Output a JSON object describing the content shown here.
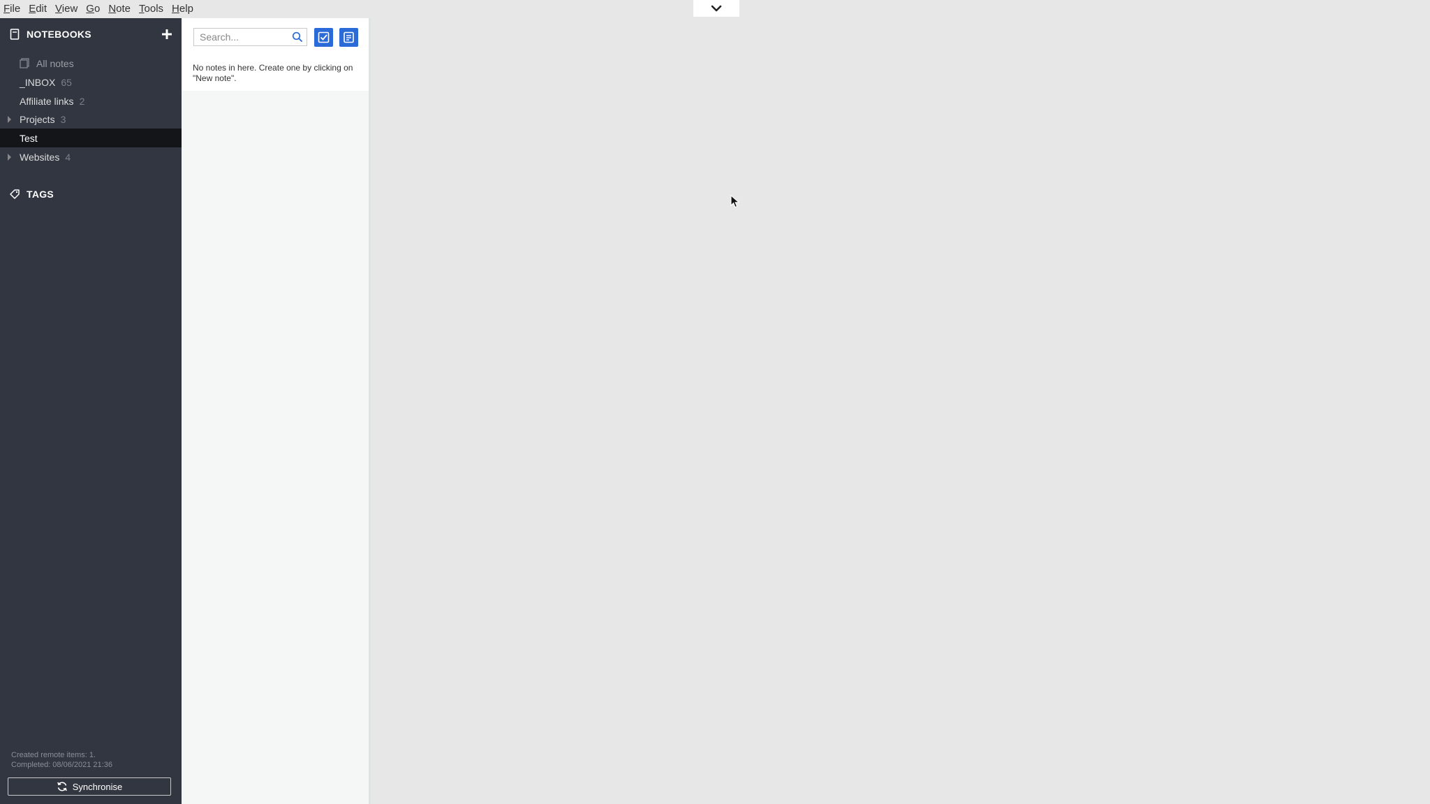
{
  "menu": {
    "items": [
      {
        "u": "F",
        "rest": "ile"
      },
      {
        "u": "E",
        "rest": "dit"
      },
      {
        "u": "V",
        "rest": "iew"
      },
      {
        "u": "G",
        "rest": "o"
      },
      {
        "u": "N",
        "rest": "ote"
      },
      {
        "u": "T",
        "rest": "ools"
      },
      {
        "u": "H",
        "rest": "elp"
      }
    ]
  },
  "sidebar": {
    "notebooks_title": "NOTEBOOKS",
    "items": [
      {
        "label": "All notes",
        "count": ""
      },
      {
        "label": "_INBOX",
        "count": "65"
      },
      {
        "label": "Affiliate links",
        "count": "2"
      },
      {
        "label": "Projects",
        "count": "3"
      },
      {
        "label": "Test",
        "count": ""
      },
      {
        "label": "Websites",
        "count": "4"
      }
    ],
    "tags_title": "TAGS",
    "status_line1": "Created remote items: 1.",
    "status_line2": "Completed: 08/06/2021 21:36",
    "sync_label": "Synchronise"
  },
  "notelist": {
    "search_placeholder": "Search...",
    "empty_message": "No notes in here. Create one by clicking on \"New note\"."
  },
  "colors": {
    "sidebar_bg": "#313640",
    "selected_bg": "#131519",
    "accent": "#2a6bd8",
    "background": "#e7e7e7"
  }
}
